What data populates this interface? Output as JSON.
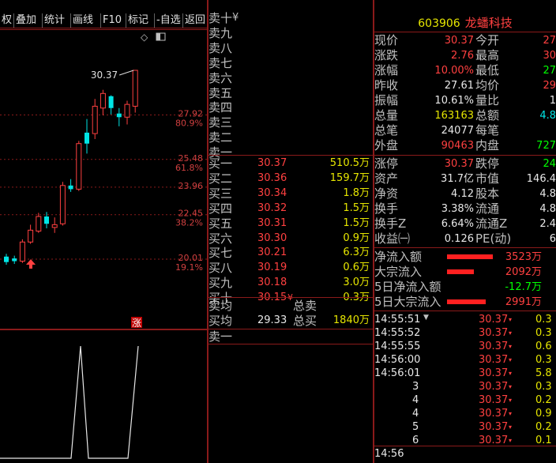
{
  "toolbar": {
    "items": [
      "权",
      "叠加",
      "统计",
      "画线",
      "F10",
      "标记",
      "-自选",
      "返回"
    ]
  },
  "chart": {
    "price_labels": [
      "27.92",
      "25.48",
      "23.96",
      "22.45",
      "20.01"
    ],
    "pct_labels": [
      "80.9%",
      "61.8%",
      "38.2%",
      "19.1%"
    ],
    "high_label": "30.37",
    "zhang_label": "涨",
    "diamond_icon": "◇",
    "candles": [
      {
        "o": 19.85,
        "c": 20.15,
        "h": 20.3,
        "l": 19.7,
        "color": "cyan"
      },
      {
        "o": 20.05,
        "c": 19.9,
        "h": 20.2,
        "l": 19.75,
        "color": "cyan"
      },
      {
        "o": 19.9,
        "c": 20.95,
        "h": 21.1,
        "l": 19.8,
        "color": "red"
      },
      {
        "o": 20.95,
        "c": 21.6,
        "h": 21.9,
        "l": 20.85,
        "color": "red"
      },
      {
        "o": 21.55,
        "c": 22.35,
        "h": 22.55,
        "l": 21.45,
        "color": "red"
      },
      {
        "o": 22.35,
        "c": 21.95,
        "h": 22.6,
        "l": 21.7,
        "color": "cyan"
      },
      {
        "o": 21.75,
        "c": 21.9,
        "h": 22.3,
        "l": 21.45,
        "color": "red"
      },
      {
        "o": 21.95,
        "c": 24.05,
        "h": 24.25,
        "l": 21.85,
        "color": "red"
      },
      {
        "o": 24.05,
        "c": 23.85,
        "h": 24.4,
        "l": 23.7,
        "color": "cyan"
      },
      {
        "o": 23.85,
        "c": 26.35,
        "h": 26.5,
        "l": 23.75,
        "color": "red"
      },
      {
        "o": 26.35,
        "c": 26.95,
        "h": 27.7,
        "l": 25.8,
        "color": "cyan"
      },
      {
        "o": 26.9,
        "c": 28.4,
        "h": 28.8,
        "l": 26.6,
        "color": "red"
      },
      {
        "o": 28.3,
        "c": 29.1,
        "h": 29.3,
        "l": 27.9,
        "color": "red"
      },
      {
        "o": 28.95,
        "c": 28.3,
        "h": 29.0,
        "l": 27.95,
        "color": "cyan"
      },
      {
        "o": 28.0,
        "c": 27.8,
        "h": 28.3,
        "l": 27.3,
        "color": "cyan"
      },
      {
        "o": 27.8,
        "c": 28.5,
        "h": 28.7,
        "l": 27.4,
        "color": "red"
      },
      {
        "o": 28.4,
        "c": 30.37,
        "h": 30.37,
        "l": 28.05,
        "color": "red"
      }
    ]
  },
  "orderbook": {
    "sell_labels": [
      "卖十",
      "卖九",
      "卖八",
      "卖七",
      "卖六",
      "卖五",
      "卖四",
      "卖三",
      "卖二",
      "卖一"
    ],
    "sell_top_suffix": "¥",
    "buy": [
      {
        "label": "买一",
        "price": "30.37",
        "vol": "510.5万"
      },
      {
        "label": "买二",
        "price": "30.36",
        "vol": "159.7万"
      },
      {
        "label": "买三",
        "price": "30.34",
        "vol": "1.8万"
      },
      {
        "label": "买四",
        "price": "30.32",
        "vol": "1.5万"
      },
      {
        "label": "买五",
        "price": "30.31",
        "vol": "1.5万"
      },
      {
        "label": "买六",
        "price": "30.30",
        "vol": "0.9万"
      },
      {
        "label": "买七",
        "price": "30.21",
        "vol": "6.3万"
      },
      {
        "label": "买八",
        "price": "30.19",
        "vol": "0.6万"
      },
      {
        "label": "买九",
        "price": "30.18",
        "vol": "3.0万"
      },
      {
        "label": "买十",
        "price": "30.15",
        "vol": "0.3万"
      }
    ],
    "buy_last_marker": "¥",
    "sell_avg_label": "卖均",
    "sell_total_label": "总卖",
    "buy_avg_label": "买均",
    "buy_avg": "29.33",
    "buy_total_label": "总买",
    "buy_total": "1840万",
    "sell_one": "卖一"
  },
  "stock": {
    "code": "603906",
    "name": "龙蟠科技"
  },
  "quote": [
    {
      "k": "现价",
      "v": "30.37",
      "c": "red",
      "k2": "今开",
      "v2": "27",
      "c2": "red"
    },
    {
      "k": "涨跌",
      "v": "2.76",
      "c": "red",
      "k2": "最高",
      "v2": "30",
      "c2": "red"
    },
    {
      "k": "涨幅",
      "v": "10.00%",
      "c": "red",
      "k2": "最低",
      "v2": "27",
      "c2": "green"
    },
    {
      "k": "昨收",
      "v": "27.61",
      "c": "white",
      "k2": "均价",
      "v2": "29",
      "c2": "red"
    },
    {
      "k": "振幅",
      "v": "10.61%",
      "c": "white",
      "k2": "量比",
      "v2": "1",
      "c2": "white"
    },
    {
      "k": "总量",
      "v": "163163",
      "c": "yellow",
      "k2": "总额",
      "v2": "4.8",
      "c2": "cyan"
    },
    {
      "k": "总笔",
      "v": "24077",
      "c": "white",
      "k2": "每笔",
      "v2": "",
      "c2": "white"
    },
    {
      "k": "外盘",
      "v": "90463",
      "c": "red",
      "k2": "内盘",
      "v2": "727",
      "c2": "green"
    }
  ],
  "fundamentals": [
    {
      "k": "涨停",
      "v": "30.37",
      "c": "red",
      "k2": "跌停",
      "v2": "24",
      "c2": "green"
    },
    {
      "k": "资产",
      "v": "31.7亿",
      "c": "white",
      "k2": "市值",
      "v2": "146.4",
      "c2": "white"
    },
    {
      "k": "净资",
      "v": "4.12",
      "c": "white",
      "k2": "股本",
      "v2": "4.8",
      "c2": "white"
    },
    {
      "k": "换手",
      "v": "3.38%",
      "c": "white",
      "k2": "流通",
      "v2": "4.8",
      "c2": "white"
    },
    {
      "k": "换手Z",
      "v": "6.64%",
      "c": "white",
      "k2": "流通Z",
      "v2": "2.4",
      "c2": "white"
    },
    {
      "k": "收益㈠",
      "v": "0.126",
      "c": "white",
      "k2": "PE(动)",
      "v2": "6",
      "c2": "white"
    }
  ],
  "flows": [
    {
      "k": "净流入额",
      "v": "3523万",
      "c": "red",
      "bar": 1.0
    },
    {
      "k": "大宗流入",
      "v": "2092万",
      "c": "red",
      "bar": 0.59
    },
    {
      "k": "5日净流入额",
      "v": "-12.7万",
      "c": "green",
      "bar": 0
    },
    {
      "k": "5日大宗流入",
      "v": "2991万",
      "c": "red",
      "bar": 0.85
    }
  ],
  "ticks": [
    {
      "t": "14:55:51",
      "p": "30.37",
      "v": "0.3"
    },
    {
      "t": "14:55:52",
      "p": "30.37",
      "v": "0.3"
    },
    {
      "t": "14:55:55",
      "p": "30.37",
      "v": "0.6"
    },
    {
      "t": "14:56:00",
      "p": "30.37",
      "v": "0.3"
    },
    {
      "t": "14:56:01",
      "p": "30.37",
      "v": "5.8"
    },
    {
      "t": "3",
      "p": "30.37",
      "v": "0.3"
    },
    {
      "t": "4",
      "p": "30.37",
      "v": "0.2"
    },
    {
      "t": "4",
      "p": "30.37",
      "v": "0.9"
    },
    {
      "t": "5",
      "p": "30.37",
      "v": "0.2"
    },
    {
      "t": "6",
      "p": "30.37",
      "v": "0.1"
    }
  ],
  "tick_arrow": "▼",
  "bottom_time": "14:56",
  "colors": {
    "red": "#ff4040",
    "green": "#00ff00",
    "cyan": "#00e5e5",
    "yellow": "#e6e600",
    "gridRed": "#8a1a1a"
  }
}
